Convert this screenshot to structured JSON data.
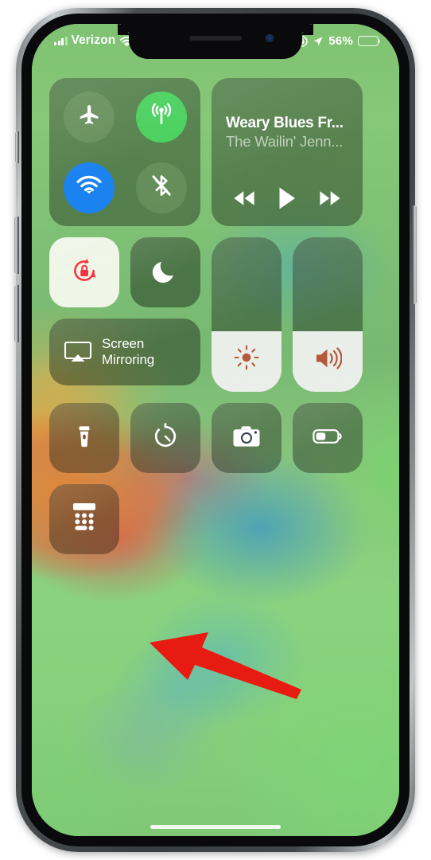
{
  "device": {
    "name": "iPhone X",
    "notch": {
      "speaker": "earpiece-speaker",
      "camera": "front-camera"
    },
    "side_buttons": [
      "mute-switch",
      "volume-up",
      "volume-down",
      "power-button"
    ],
    "home_indicator": "home-indicator"
  },
  "status_bar": {
    "carrier": "Verizon",
    "signal_icon": "cellular-signal-icon",
    "signal_bars_filled": 3,
    "signal_bars_total": 4,
    "wifi_icon": "wifi-icon",
    "alarm_icon": "alarm-clock-icon",
    "rotation_lock_icon": "rotation-lock-icon",
    "location_icon": "location-arrow-icon",
    "battery_percent": "56%",
    "battery_level": 56,
    "battery_icon": "battery-icon"
  },
  "control_center": {
    "connectivity": {
      "airplane_mode": {
        "icon": "airplane-icon",
        "label": "Airplane Mode",
        "state": "off"
      },
      "cellular_data": {
        "icon": "cellular-data-icon",
        "label": "Cellular Data",
        "state": "on"
      },
      "wifi": {
        "icon": "wifi-icon",
        "label": "Wi-Fi",
        "state": "on"
      },
      "bluetooth": {
        "icon": "bluetooth-off-icon",
        "label": "Bluetooth",
        "state": "off"
      }
    },
    "now_playing": {
      "title": "Weary Blues Fr...",
      "artist": "The Wailin' Jenn...",
      "rewind_icon": "rewind-icon",
      "play_icon": "play-icon",
      "fast_forward_icon": "fast-forward-icon"
    },
    "orientation_lock": {
      "icon": "rotation-lock-icon",
      "label": "Portrait Orientation Lock",
      "state": "on",
      "accent": "#f4333c"
    },
    "do_not_disturb": {
      "icon": "moon-icon",
      "label": "Do Not Disturb",
      "state": "off"
    },
    "screen_mirroring": {
      "icon": "airplay-screen-icon",
      "label": "Screen\nMirroring",
      "line1": "Screen",
      "line2": "Mirroring"
    },
    "brightness": {
      "icon": "brightness-icon",
      "label": "Display Brightness",
      "value": 39,
      "fill_color": "#ffffff"
    },
    "volume": {
      "icon": "volume-icon",
      "label": "Volume",
      "value": 39,
      "fill_color": "#ffffff"
    },
    "utilities": [
      {
        "icon": "flashlight-icon",
        "label": "Flashlight",
        "state": "off"
      },
      {
        "icon": "timer-icon",
        "label": "Timer",
        "state": "off"
      },
      {
        "icon": "camera-icon",
        "label": "Camera",
        "state": "off"
      },
      {
        "icon": "low-power-mode-icon",
        "label": "Low Power Mode",
        "state": "off"
      }
    ],
    "calculator": {
      "icon": "calculator-icon",
      "label": "Calculator",
      "state": "off"
    }
  },
  "annotation": {
    "arrow": {
      "name": "red-pointer-arrow",
      "color": "#e81b12",
      "points_to": "calculator-tile"
    }
  }
}
